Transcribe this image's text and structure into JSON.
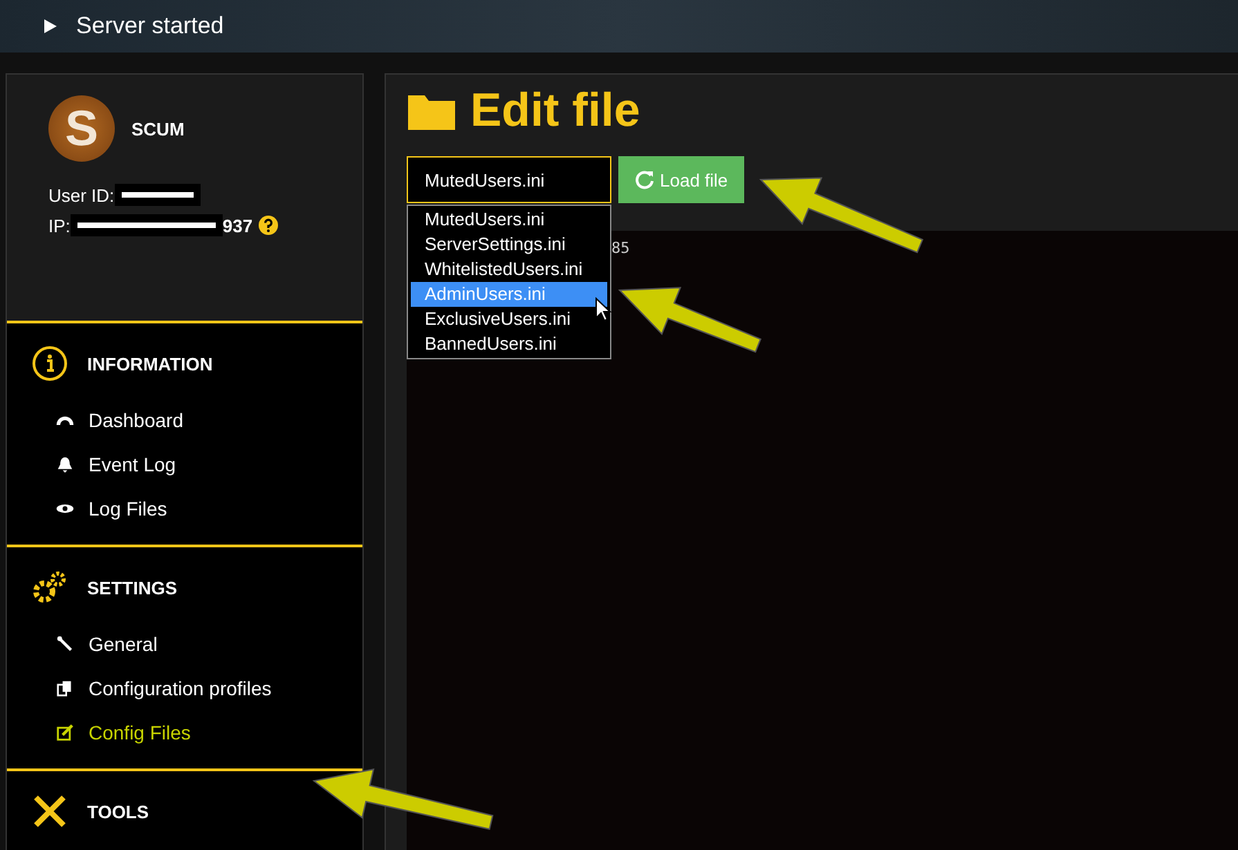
{
  "banner": {
    "text": "Server started"
  },
  "profile": {
    "logo_letter": "S",
    "name": "SCUM",
    "user_id_label": "User ID:",
    "ip_label": "IP:",
    "ip_suffix": "937"
  },
  "nav_sections": [
    {
      "title": "INFORMATION",
      "kind": "info",
      "items": [
        {
          "label": "Dashboard",
          "kind": "gauge",
          "selected": false
        },
        {
          "label": "Event Log",
          "kind": "bell",
          "selected": false
        },
        {
          "label": "Log Files",
          "kind": "eye",
          "selected": false
        }
      ]
    },
    {
      "title": "SETTINGS",
      "kind": "gears",
      "items": [
        {
          "label": "General",
          "kind": "wrench",
          "selected": false
        },
        {
          "label": "Configuration profiles",
          "kind": "copy",
          "selected": false
        },
        {
          "label": "Config Files",
          "kind": "edit",
          "selected": true
        }
      ]
    },
    {
      "title": "TOOLS",
      "kind": "tools"
    }
  ],
  "page_title": "Edit file",
  "file_select": {
    "value": "MutedUsers.ini",
    "expanded": true,
    "options": [
      {
        "label": "MutedUsers.ini",
        "highlighted": false
      },
      {
        "label": "ServerSettings.ini",
        "highlighted": false
      },
      {
        "label": "WhitelistedUsers.ini",
        "highlighted": false
      },
      {
        "label": "AdminUsers.ini",
        "highlighted": true
      },
      {
        "label": "ExclusiveUsers.ini",
        "highlighted": false
      },
      {
        "label": "BannedUsers.ini",
        "highlighted": false
      }
    ]
  },
  "load_button": {
    "label": "Load file"
  },
  "editor": {
    "text": "85"
  }
}
